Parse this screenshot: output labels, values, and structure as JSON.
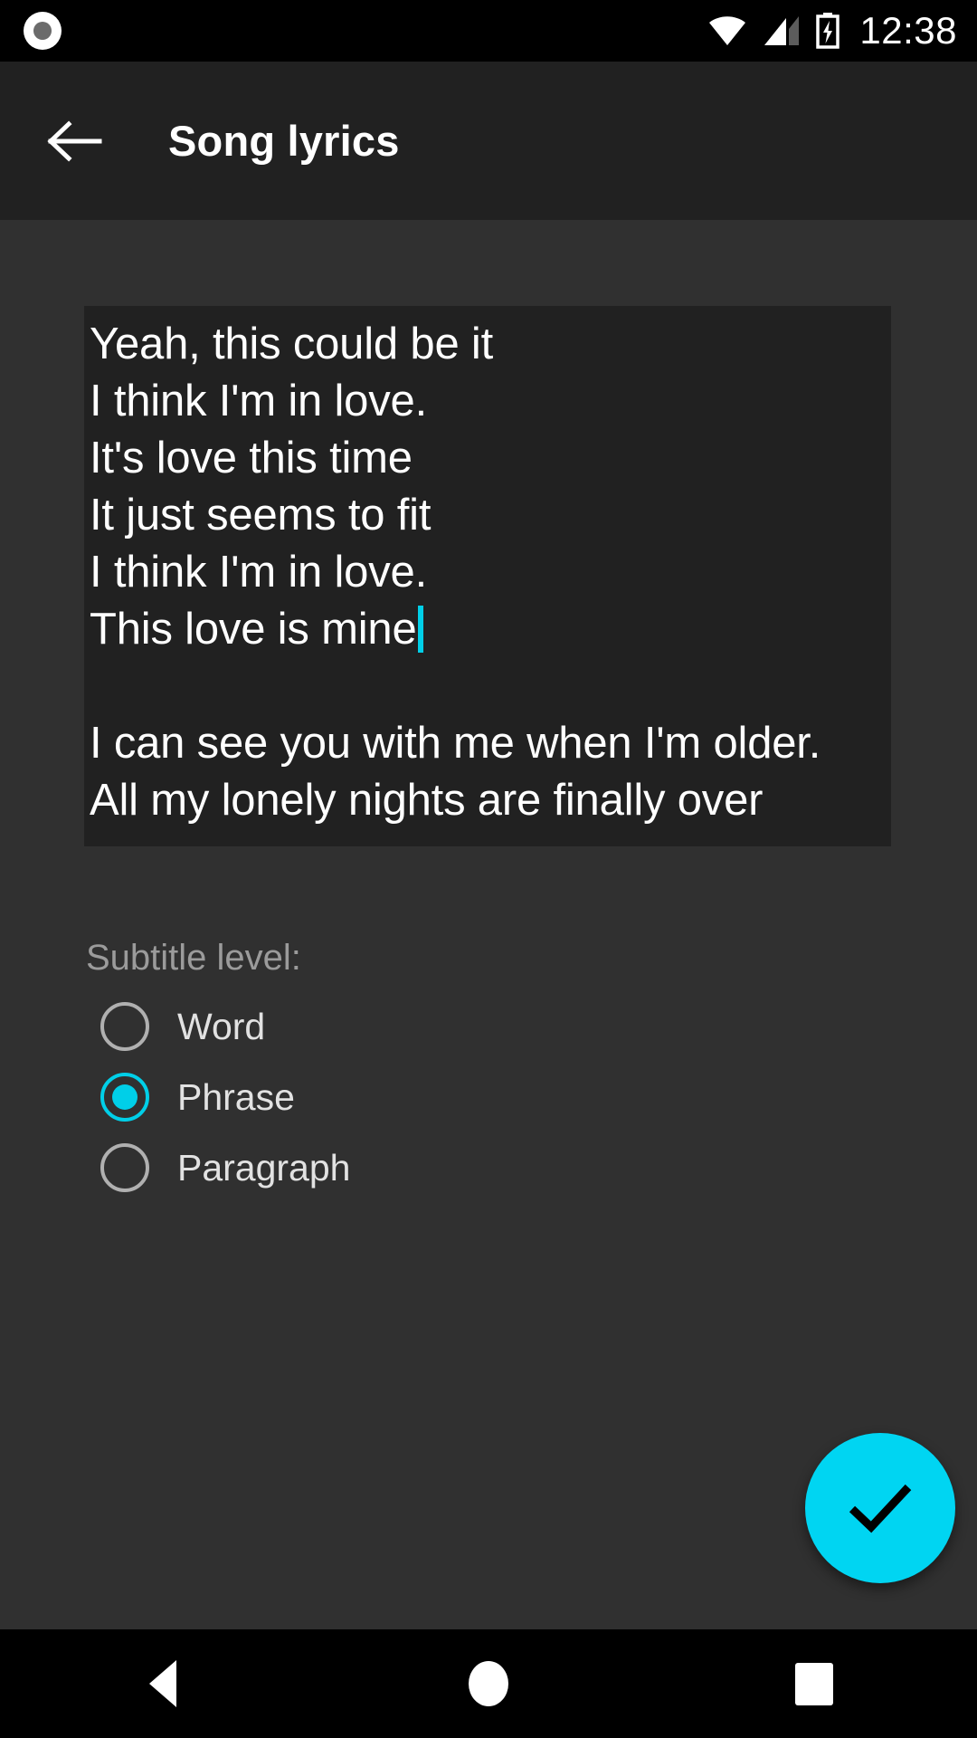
{
  "status_bar": {
    "left_icon": "camera-dot-icon",
    "wifi_icon": "wifi-icon",
    "signal_icon": "cellular-signal-icon",
    "battery_icon": "battery-charging-icon",
    "clock": "12:38"
  },
  "app_bar": {
    "back_icon": "back-arrow-icon",
    "title": "Song lyrics"
  },
  "lyrics_field": {
    "text": "Yeah, this could be it\nI think I'm in love.\nIt's love this time\nIt just seems to fit\nI think I'm in love.\nThis love is mine",
    "text_after_caret": "\n\nI can see you with me when I'm older.\nAll my lonely nights are finally over",
    "caret_color": "#00cfe8",
    "background": "#212121"
  },
  "subtitle_level": {
    "label": "Subtitle level:",
    "selected": "Phrase",
    "accent_color": "#00cfe8",
    "options": [
      {
        "label": "Word",
        "selected": false
      },
      {
        "label": "Phrase",
        "selected": true
      },
      {
        "label": "Paragraph",
        "selected": false
      }
    ]
  },
  "fab": {
    "icon": "check-icon",
    "color": "#00d5f2"
  },
  "nav_bar": {
    "back": "nav-back-icon",
    "home": "nav-home-icon",
    "recents": "nav-recents-icon"
  }
}
